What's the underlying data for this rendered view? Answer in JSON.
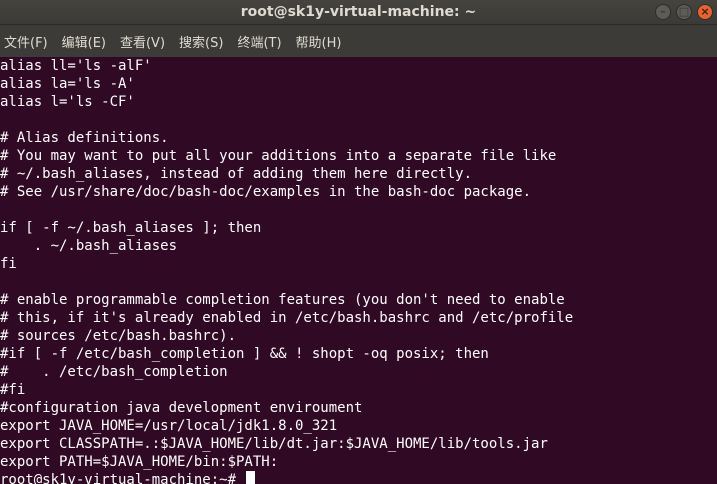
{
  "window": {
    "title": "root@sk1y-virtual-machine: ~",
    "minimize_label": "–",
    "maximize_label": "□",
    "close_label": "×"
  },
  "menu": {
    "items": [
      "文件(F)",
      "编辑(E)",
      "查看(V)",
      "搜索(S)",
      "终端(T)",
      "帮助(H)"
    ]
  },
  "terminal": {
    "lines": [
      "alias ll='ls -alF'",
      "alias la='ls -A'",
      "alias l='ls -CF'",
      "",
      "# Alias definitions.",
      "# You may want to put all your additions into a separate file like",
      "# ~/.bash_aliases, instead of adding them here directly.",
      "# See /usr/share/doc/bash-doc/examples in the bash-doc package.",
      "",
      "if [ -f ~/.bash_aliases ]; then",
      "    . ~/.bash_aliases",
      "fi",
      "",
      "# enable programmable completion features (you don't need to enable",
      "# this, if it's already enabled in /etc/bash.bashrc and /etc/profile",
      "# sources /etc/bash.bashrc).",
      "#if [ -f /etc/bash_completion ] && ! shopt -oq posix; then",
      "#    . /etc/bash_completion",
      "#fi",
      "#configuration java development enviroument",
      "export JAVA_HOME=/usr/local/jdk1.8.0_321",
      "export CLASSPATH=.:$JAVA_HOME/lib/dt.jar:$JAVA_HOME/lib/tools.jar",
      "export PATH=$JAVA_HOME/bin:$PATH:"
    ],
    "prompt": "root@sk1y-virtual-machine:~# "
  },
  "colors": {
    "terminal_bg": "#300a24",
    "titlebar_bg": "#3c3b37",
    "close_button": "#e9632f"
  }
}
